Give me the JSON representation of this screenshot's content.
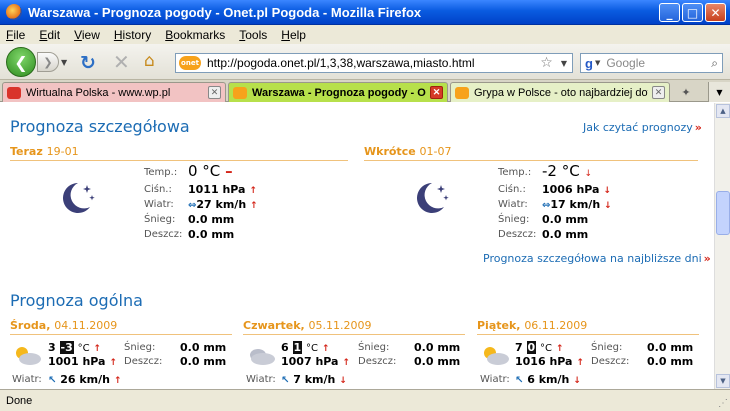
{
  "window": {
    "title": "Warszawa - Prognoza pogody - Onet.pl Pogoda - Mozilla Firefox",
    "min": "_",
    "max": "□",
    "close": "✕"
  },
  "menu": [
    "File",
    "Edit",
    "View",
    "History",
    "Bookmarks",
    "Tools",
    "Help"
  ],
  "nav": {
    "url": "http://pogoda.onet.pl/1,3,38,warszawa,miasto.html",
    "site_icon": "onet",
    "search_placeholder": "Google"
  },
  "tabs": [
    {
      "label": "Wirtualna Polska - www.wp.pl",
      "icon": "wp-icon"
    },
    {
      "label": "Warszawa - Prognoza pogody - O...",
      "icon": "onet-icon",
      "active": true
    },
    {
      "label": "Grypa w Polsce - oto najbardziej dotkni...",
      "icon": "onet-icon"
    }
  ],
  "detail": {
    "heading": "Prognoza szczegółowa",
    "how_to_read": "Jak czytać prognozy",
    "more_days": "Prognoza szczegółowa na najbliższe dni",
    "now": {
      "head": "Teraz",
      "date": "19-01",
      "temp_label": "Temp.:",
      "temp": "0 °C",
      "pressure_label": "Ciśn.:",
      "pressure": "1011 hPa",
      "wind_label": "Wiatr:",
      "wind": "27 km/h",
      "snow_label": "Śnieg:",
      "snow": "0.0 mm",
      "rain_label": "Deszcz:",
      "rain": "0.0 mm"
    },
    "soon": {
      "head": "Wkrótce",
      "date": "01-07",
      "temp_label": "Temp.:",
      "temp": "-2 °C",
      "pressure_label": "Ciśn.:",
      "pressure": "1006 hPa",
      "wind_label": "Wiatr:",
      "wind": "17 km/h",
      "snow_label": "Śnieg:",
      "snow": "0.0 mm",
      "rain_label": "Deszcz:",
      "rain": "0.0 mm"
    }
  },
  "general": {
    "heading": "Prognoza ogólna",
    "days": [
      {
        "day": "Środa",
        "date": "04.11.2009",
        "t_day": "3",
        "t_night": "-3",
        "unit": "°C",
        "pressure": "1001 hPa",
        "snow_label": "Śnieg:",
        "snow": "0.0 mm",
        "rain_label": "Deszcz:",
        "rain": "0.0 mm",
        "wind_label": "Wiatr:",
        "wind": "26 km/h",
        "icon": "sun-cloud-icon"
      },
      {
        "day": "Czwartek",
        "date": "05.11.2009",
        "t_day": "6",
        "t_night": "1",
        "unit": "°C",
        "pressure": "1007 hPa",
        "snow_label": "Śnieg:",
        "snow": "0.0 mm",
        "rain_label": "Deszcz:",
        "rain": "0.0 mm",
        "wind_label": "Wiatr:",
        "wind": "7 km/h",
        "icon": "cloud-icon"
      },
      {
        "day": "Piątek",
        "date": "06.11.2009",
        "t_day": "7",
        "t_night": "0",
        "unit": "°C",
        "pressure": "1016 hPa",
        "snow_label": "Śnieg:",
        "snow": "0.0 mm",
        "rain_label": "Deszcz:",
        "rain": "0.0 mm",
        "wind_label": "Wiatr:",
        "wind": "6 km/h",
        "icon": "sun-cloud-icon"
      }
    ]
  },
  "status": "Done",
  "colors": {
    "accent": "#1c6cb4",
    "orange": "#e6951b",
    "arrow": "#d4261a"
  }
}
